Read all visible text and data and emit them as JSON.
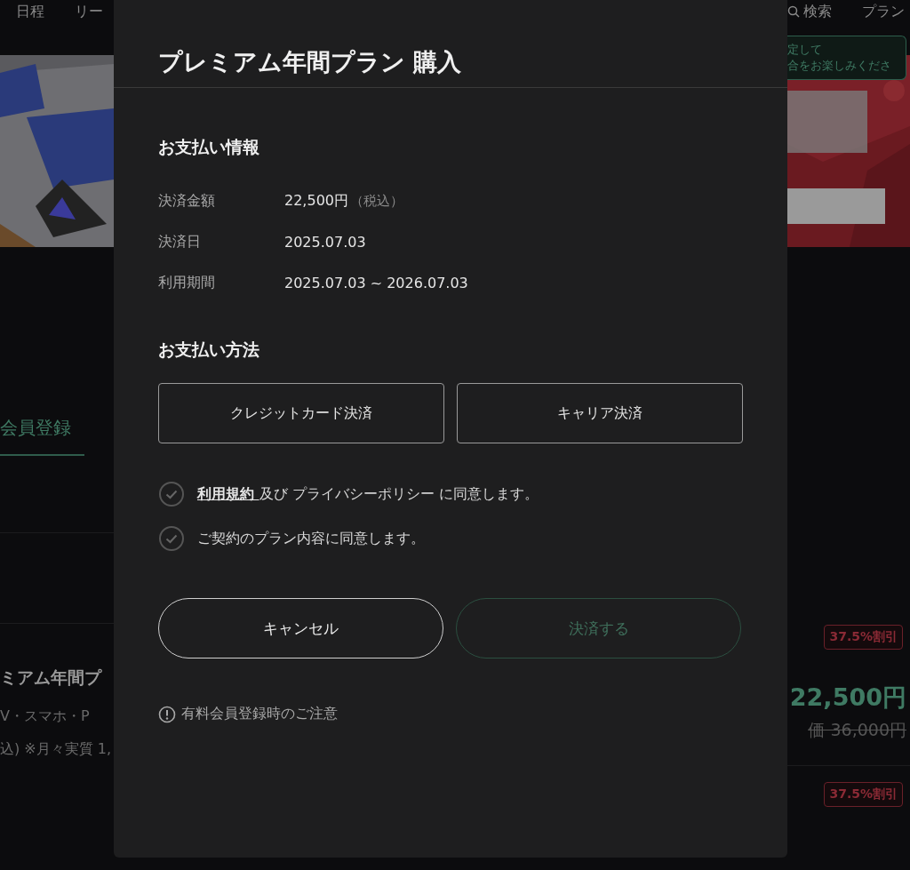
{
  "background": {
    "nav_left": [
      "日程",
      "リー"
    ],
    "nav_right": [
      {
        "kind": "search",
        "label": "検索"
      },
      {
        "kind": "text",
        "label": "プラン"
      }
    ],
    "tooltip": [
      "定して",
      "合をお楽しみくださ"
    ],
    "tab": {
      "label": "会員登録",
      "selected": true
    },
    "plan": {
      "name": "ミアム年間プ",
      "devices": "V・スマホ・P",
      "note": "込) ※月々実質 1,"
    },
    "offers": [
      {
        "badge": "37.5%割引",
        "price": "22,500円",
        "original_price": "価 36,000円"
      },
      {
        "badge": "37.5%割引"
      }
    ]
  },
  "modal": {
    "title": "プレミアム年間プラン 購入",
    "payment_info": {
      "heading": "お支払い情報",
      "rows": [
        {
          "label": "決済金額",
          "value": "22,500円",
          "note": "（税込）"
        },
        {
          "label": "決済日",
          "value": "2025.07.03"
        },
        {
          "label": "利用期間",
          "value": "2025.07.03 ~ 2026.07.03"
        }
      ]
    },
    "payment_method": {
      "heading": "お支払い方法",
      "options": [
        {
          "label": "クレジットカード決済",
          "selected": false
        },
        {
          "label": "キャリア決済",
          "selected": false
        }
      ]
    },
    "agreements": [
      {
        "link": "利用規約 ",
        "text": "及び プライバシーポリシー に同意します。",
        "checked": false
      },
      {
        "text": "ご契約のプラン内容に同意します。",
        "checked": false
      }
    ],
    "actions": [
      {
        "kind": "cancel",
        "label": "キャンセル",
        "disabled": false
      },
      {
        "kind": "submit",
        "label": "決済する",
        "disabled": true
      }
    ],
    "notice": "有料会員登録時のご注意"
  }
}
